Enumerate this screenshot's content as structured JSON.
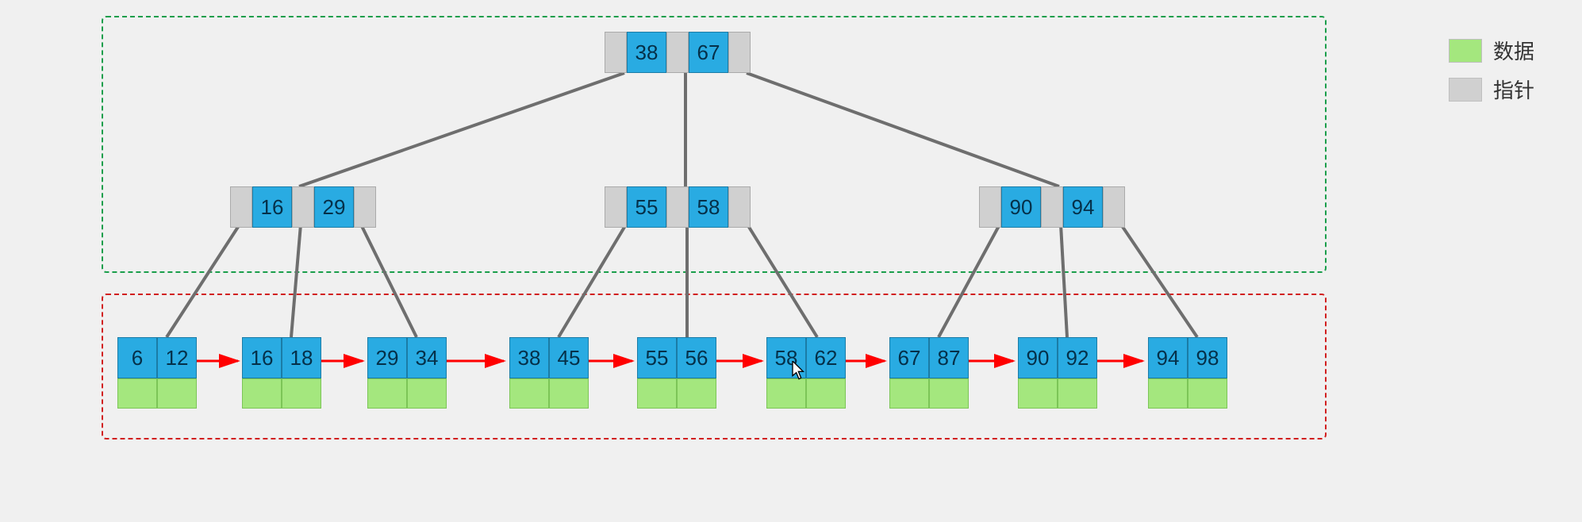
{
  "legend": {
    "data": "数据",
    "pointer": "指针"
  },
  "colors": {
    "key": "#29abe2",
    "data": "#a4e77e",
    "pointer": "#d0d0d0",
    "indexBox": "#1a9e4b",
    "leafBox": "#d11f1f",
    "arrow": "#ff0000",
    "edge": "#6e6e6e"
  },
  "root": {
    "keys": [
      "38",
      "67"
    ]
  },
  "internal": [
    {
      "keys": [
        "16",
        "29"
      ]
    },
    {
      "keys": [
        "55",
        "58"
      ]
    },
    {
      "keys": [
        "90",
        "94"
      ]
    }
  ],
  "leaves": [
    {
      "keys": [
        "6",
        "12"
      ]
    },
    {
      "keys": [
        "16",
        "18"
      ]
    },
    {
      "keys": [
        "29",
        "34"
      ]
    },
    {
      "keys": [
        "38",
        "45"
      ]
    },
    {
      "keys": [
        "55",
        "56"
      ]
    },
    {
      "keys": [
        "58",
        "62"
      ]
    },
    {
      "keys": [
        "67",
        "87"
      ]
    },
    {
      "keys": [
        "90",
        "92"
      ]
    },
    {
      "keys": [
        "94",
        "98"
      ]
    }
  ],
  "chart_data": {
    "type": "tree",
    "structure": "B+ tree, order 3 (2 keys / 3 pointers per internal node)",
    "root_keys": [
      38,
      67
    ],
    "internal_keys": [
      [
        16,
        29
      ],
      [
        55,
        58
      ],
      [
        90,
        94
      ]
    ],
    "leaf_keys": [
      [
        6,
        12
      ],
      [
        16,
        18
      ],
      [
        29,
        34
      ],
      [
        38,
        45
      ],
      [
        55,
        56
      ],
      [
        58,
        62
      ],
      [
        67,
        87
      ],
      [
        90,
        92
      ],
      [
        94,
        98
      ]
    ],
    "leaf_linked_list": true,
    "legend": {
      "green_cell": "数据 (data)",
      "grey_cell": "指针 (pointer)"
    },
    "dashed_green_box": "index / internal levels",
    "dashed_red_box": "leaf level"
  }
}
